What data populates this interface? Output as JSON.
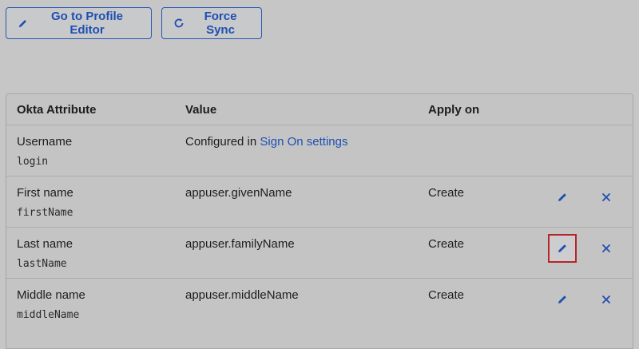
{
  "toolbar": {
    "profile_editor_label": "Go to Profile Editor",
    "force_sync_label": "Force Sync"
  },
  "table": {
    "headers": {
      "attribute": "Okta Attribute",
      "value": "Value",
      "apply_on": "Apply on"
    },
    "rows": [
      {
        "label": "Username",
        "variable": "login",
        "value_prefix": "Configured in ",
        "value_link": "Sign On settings",
        "apply_on": ""
      },
      {
        "label": "First name",
        "variable": "firstName",
        "value": "appuser.givenName",
        "apply_on": "Create"
      },
      {
        "label": "Last name",
        "variable": "lastName",
        "value": "appuser.familyName",
        "apply_on": "Create"
      },
      {
        "label": "Middle name",
        "variable": "middleName",
        "value": "appuser.middleName",
        "apply_on": "Create"
      }
    ]
  },
  "icons": {
    "edit": "pencil-icon",
    "delete": "close-icon",
    "sync": "refresh-icon"
  },
  "colors": {
    "accent": "#1e4fb3",
    "focus_ring": "#b3262b"
  }
}
